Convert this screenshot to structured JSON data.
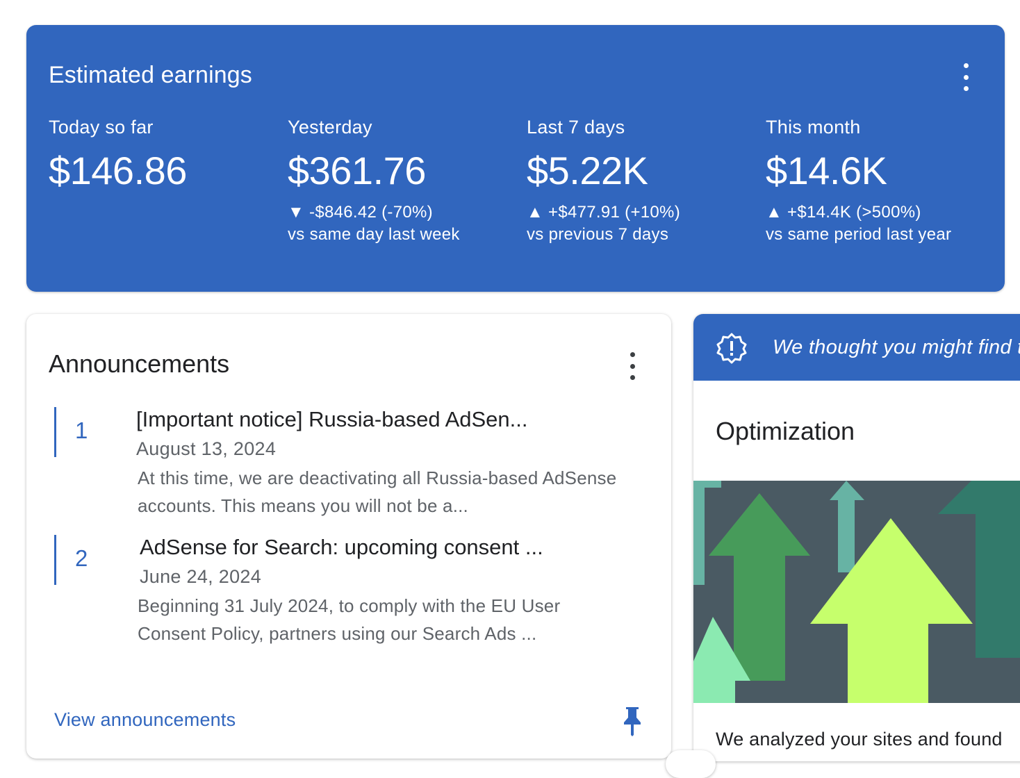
{
  "earnings": {
    "title": "Estimated earnings",
    "menu_icon": "more-vert-icon",
    "metrics": [
      {
        "label": "Today so far",
        "value": "$146.86",
        "change": "",
        "comparison": ""
      },
      {
        "label": "Yesterday",
        "value": "$361.76",
        "change": "▼ -$846.42 (-70%)",
        "comparison": "vs same day last week"
      },
      {
        "label": "Last 7 days",
        "value": "$5.22K",
        "change": "▲ +$477.91 (+10%)",
        "comparison": "vs previous 7 days"
      },
      {
        "label": "This month",
        "value": "$14.6K",
        "change": "▲ +$14.4K (>500%)",
        "comparison": "vs same period last year"
      }
    ]
  },
  "announcements": {
    "title": "Announcements",
    "menu_icon": "more-vert-icon",
    "items": [
      {
        "number": "1",
        "headline": "[Important notice] Russia-based AdSen...",
        "date": "August 13, 2024",
        "body": "At this time, we are deactivating all Russia-based AdSense accounts. This means you will not be a..."
      },
      {
        "number": "2",
        "headline": "AdSense for Search: upcoming consent ...",
        "date": "June 24, 2024",
        "body": "Beginning 31 July 2024, to comply with the EU User Consent Policy, partners using our Search Ads ..."
      }
    ],
    "view_link": "View announcements",
    "pin_icon": "pin-icon"
  },
  "optimization": {
    "banner_text": "We thought you might find this useful",
    "banner_icon": "alert-badge-icon",
    "title": "Optimization",
    "body": "We analyzed your sites and found"
  },
  "colors": {
    "brand_blue": "#3166be",
    "arrow_bg": "#4a5a63",
    "arrow_lime": "#c6ff6c",
    "arrow_green": "#479b5a",
    "arrow_teal": "#67b3a4",
    "arrow_dark_teal": "#327a6b",
    "arrow_mint": "#8beab1"
  }
}
